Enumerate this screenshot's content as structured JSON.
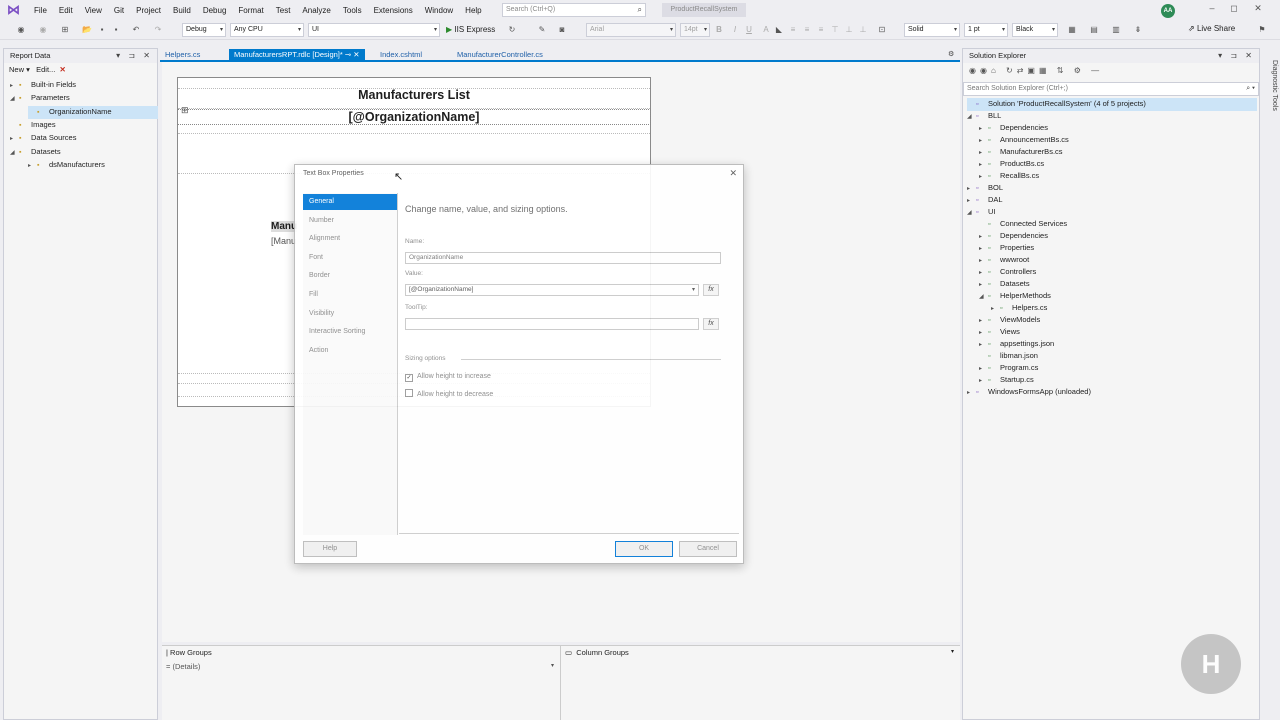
{
  "menu": [
    "File",
    "Edit",
    "View",
    "Git",
    "Project",
    "Build",
    "Debug",
    "Format",
    "Test",
    "Analyze",
    "Tools",
    "Extensions",
    "Window",
    "Help"
  ],
  "search": {
    "placeholder": "Search (Ctrl+Q)"
  },
  "project_title": "ProductRecallSystem",
  "user_initials": "AA",
  "toolbar": {
    "config": "Debug",
    "platform": "Any CPU",
    "startup": "UI",
    "run_label": "IIS Express",
    "font": "Arial",
    "font_size": "14pt",
    "border_style": "Solid",
    "border_width": "1 pt",
    "border_color": "Black",
    "live_share": "Live Share"
  },
  "report_data": {
    "title": "Report Data",
    "new_label": "New ▾",
    "edit_label": "Edit...",
    "items": [
      {
        "label": "Built-in Fields",
        "level": 0,
        "expand": "▸"
      },
      {
        "label": "Parameters",
        "level": 0,
        "expand": "◢"
      },
      {
        "label": "OrganizationName",
        "level": 1,
        "expand": ""
      },
      {
        "label": "Images",
        "level": 0,
        "expand": ""
      },
      {
        "label": "Data Sources",
        "level": 0,
        "expand": "▸"
      },
      {
        "label": "Datasets",
        "level": 0,
        "expand": "◢"
      },
      {
        "label": "dsManufacturers",
        "level": 1,
        "expand": "▸"
      }
    ]
  },
  "tabs": [
    {
      "label": "Helpers.cs"
    },
    {
      "label": "ManufacturersRPT.rdlc [Design]*"
    },
    {
      "label": "Index.cshtml"
    },
    {
      "label": "ManufacturerController.cs"
    }
  ],
  "report": {
    "title": "Manufacturers List",
    "param": "[@OrganizationName]",
    "col_header": "Manu",
    "col_value": "[Manu"
  },
  "dialog": {
    "title": "Text Box Properties",
    "nav": [
      "General",
      "Number",
      "Alignment",
      "Font",
      "Border",
      "Fill",
      "Visibility",
      "Interactive Sorting",
      "Action"
    ],
    "heading": "Change name, value, and sizing options.",
    "name_label": "Name:",
    "name_value": "OrganizationName",
    "value_label": "Value:",
    "value_value": "[@OrganizationName]",
    "tooltip_label": "ToolTip:",
    "tooltip_value": "",
    "fx": "fx",
    "sizing_label": "Sizing options",
    "grow_label": "Allow height to increase",
    "shrink_label": "Allow height to decrease",
    "help": "Help",
    "ok": "OK",
    "cancel": "Cancel"
  },
  "solution": {
    "title": "Solution Explorer",
    "search_placeholder": "Search Solution Explorer (Ctrl+;)",
    "items": [
      {
        "label": "Solution 'ProductRecallSystem' (4 of 5 projects)",
        "level": 0,
        "expand": ""
      },
      {
        "label": "BLL",
        "level": 0,
        "expand": "◢"
      },
      {
        "label": "Dependencies",
        "level": 1,
        "expand": "▸"
      },
      {
        "label": "AnnouncementBs.cs",
        "level": 1,
        "expand": "▸"
      },
      {
        "label": "ManufacturerBs.cs",
        "level": 1,
        "expand": "▸"
      },
      {
        "label": "ProductBs.cs",
        "level": 1,
        "expand": "▸"
      },
      {
        "label": "RecallBs.cs",
        "level": 1,
        "expand": "▸"
      },
      {
        "label": "BOL",
        "level": 0,
        "expand": "▸"
      },
      {
        "label": "DAL",
        "level": 0,
        "expand": "▸"
      },
      {
        "label": "UI",
        "level": 0,
        "expand": "◢"
      },
      {
        "label": "Connected Services",
        "level": 1,
        "expand": ""
      },
      {
        "label": "Dependencies",
        "level": 1,
        "expand": "▸"
      },
      {
        "label": "Properties",
        "level": 1,
        "expand": "▸"
      },
      {
        "label": "wwwroot",
        "level": 1,
        "expand": "▸"
      },
      {
        "label": "Controllers",
        "level": 1,
        "expand": "▸"
      },
      {
        "label": "Datasets",
        "level": 1,
        "expand": "▸"
      },
      {
        "label": "HelperMethods",
        "level": 1,
        "expand": "◢"
      },
      {
        "label": "Helpers.cs",
        "level": 2,
        "expand": "▸"
      },
      {
        "label": "ViewModels",
        "level": 1,
        "expand": "▸"
      },
      {
        "label": "Views",
        "level": 1,
        "expand": "▸"
      },
      {
        "label": "appsettings.json",
        "level": 1,
        "expand": "▸"
      },
      {
        "label": "libman.json",
        "level": 1,
        "expand": ""
      },
      {
        "label": "Program.cs",
        "level": 1,
        "expand": "▸"
      },
      {
        "label": "Startup.cs",
        "level": 1,
        "expand": "▸"
      },
      {
        "label": "WindowsFormsApp (unloaded)",
        "level": 0,
        "expand": "▸"
      }
    ]
  },
  "groups": {
    "row_title": "Row Groups",
    "row_item": "= (Details)",
    "col_title": "Column Groups"
  },
  "side_tab": "Diagnostic Tools",
  "colors": {
    "accent": "#007acc",
    "nav_active": "#0078d7",
    "background": "#eeeef2"
  }
}
